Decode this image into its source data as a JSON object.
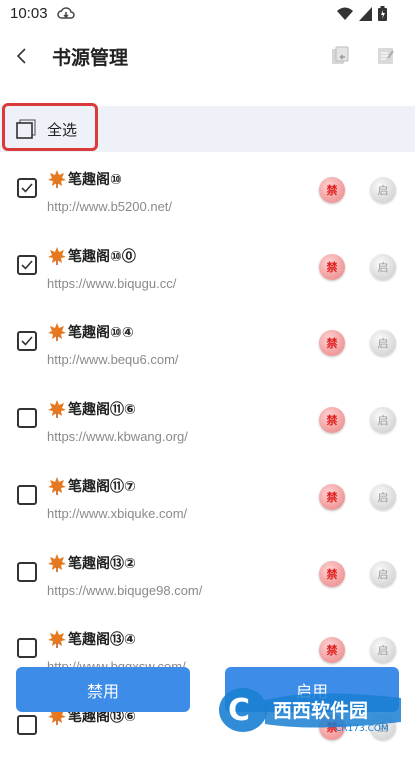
{
  "status": {
    "time": "10:03"
  },
  "header": {
    "title": "书源管理"
  },
  "select_all": {
    "label": "全选"
  },
  "items": [
    {
      "name": "笔趣阁⑩",
      "url": "http://www.b5200.net/",
      "checked": true
    },
    {
      "name": "笔趣阁⑩⓪",
      "url": "https://www.biqugu.cc/",
      "checked": true
    },
    {
      "name": "笔趣阁⑩④",
      "url": "http://www.bequ6.com/",
      "checked": true
    },
    {
      "name": "笔趣阁⑪⑥",
      "url": "https://www.kbwang.org/",
      "checked": false
    },
    {
      "name": "笔趣阁⑪⑦",
      "url": "http://www.xbiquke.com/",
      "checked": false
    },
    {
      "name": "笔趣阁⑬②",
      "url": "https://www.biquge98.com/",
      "checked": false
    },
    {
      "name": "笔趣阁⑬④",
      "url": "http://www.bqgxsw.com/",
      "checked": false
    },
    {
      "name": "笔趣阁⑬⑥",
      "url": "",
      "checked": false
    }
  ],
  "row_buttons": {
    "ban": "禁",
    "enable": "启"
  },
  "bottom": {
    "disable_label": "禁用",
    "enable_label": "启用"
  },
  "watermark": {
    "brand": "西西软件园",
    "site": "CR173.COM"
  },
  "colors": {
    "accent": "#3d8ce8",
    "highlight": "#d93a3a",
    "ban": "#e02020"
  }
}
